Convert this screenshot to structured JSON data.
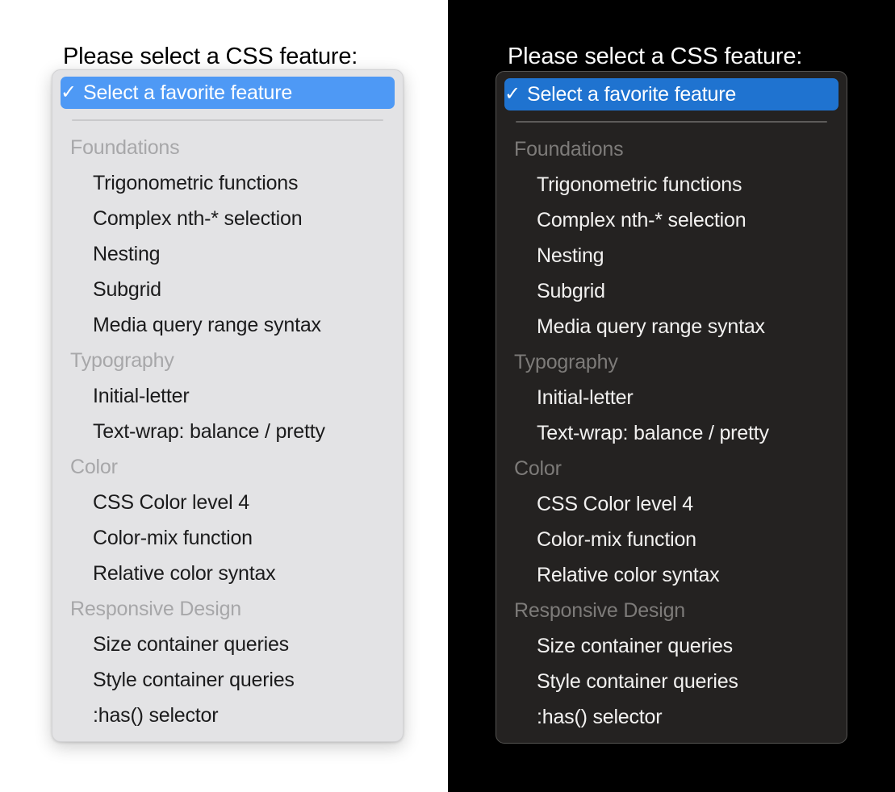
{
  "page": {
    "prompt_label": "Please select a CSS feature:",
    "check_glyph": "✓",
    "selected_option": "Select a favorite feature"
  },
  "colors": {
    "light_page_background": "#ffffff",
    "light_menu_background": "#e3e3e5",
    "light_menu_border": "#d2d2d4",
    "light_highlight": "#4e99f5",
    "light_option_text": "#1b1b1c",
    "light_group_text": "#a7a7a9",
    "light_separator": "#c9c9cb",
    "light_heading_text": "#000000",
    "dark_page_background": "#000000",
    "dark_menu_background": "#242221",
    "dark_menu_border": "#555452",
    "dark_highlight": "#1f73d0",
    "dark_option_text": "#f2f1f0",
    "dark_group_text": "#7d7b79",
    "dark_separator": "#5d5b59",
    "dark_heading_text": "#ffffff",
    "selected_label_text": "#ffffff"
  },
  "menu": {
    "groups": [
      {
        "label": "Foundations",
        "options": [
          "Trigonometric functions",
          "Complex nth-* selection",
          "Nesting",
          "Subgrid",
          "Media query range syntax"
        ]
      },
      {
        "label": "Typography",
        "options": [
          "Initial-letter",
          "Text-wrap: balance / pretty"
        ]
      },
      {
        "label": "Color",
        "options": [
          "CSS Color level 4",
          "Color-mix function",
          "Relative color syntax"
        ]
      },
      {
        "label": "Responsive Design",
        "options": [
          "Size container queries",
          "Style container queries",
          ":has() selector"
        ]
      }
    ]
  },
  "panes": [
    {
      "theme": "light"
    },
    {
      "theme": "dark"
    }
  ]
}
